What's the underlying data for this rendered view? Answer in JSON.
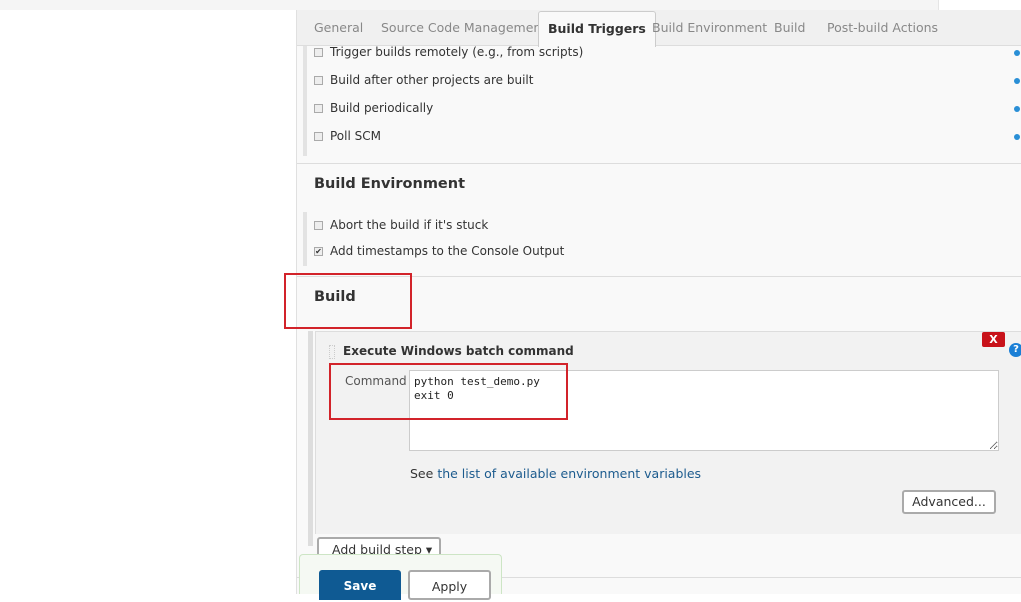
{
  "tabs": [
    {
      "label": "General"
    },
    {
      "label": "Source Code Management"
    },
    {
      "label": "Build Triggers",
      "active": true
    },
    {
      "label": "Build Environment"
    },
    {
      "label": "Build"
    },
    {
      "label": "Post-build Actions"
    }
  ],
  "triggers": [
    {
      "label": "Trigger builds remotely (e.g., from scripts)",
      "checked": false
    },
    {
      "label": "Build after other projects are built",
      "checked": false
    },
    {
      "label": "Build periodically",
      "checked": false
    },
    {
      "label": "Poll SCM",
      "checked": false
    }
  ],
  "build_env": {
    "title": "Build Environment",
    "options": [
      {
        "label": "Abort the build if it's stuck",
        "checked": false
      },
      {
        "label": "Add timestamps to the Console Output",
        "checked": true
      }
    ]
  },
  "build": {
    "title": "Build",
    "step_title": "Execute Windows batch command",
    "command_label": "Command",
    "command_value": "python test_demo.py\nexit 0",
    "see_text": "See",
    "env_link": "the list of available environment variables",
    "advanced_label": "Advanced...",
    "delete_label": "X",
    "help_label": "?",
    "add_step_label": "Add build step"
  },
  "footer": {
    "save_label": "Save",
    "apply_label": "Apply"
  },
  "colors": {
    "accent": "#1c5b8e",
    "highlight": "#d2232a",
    "save": "#0f5a93"
  }
}
